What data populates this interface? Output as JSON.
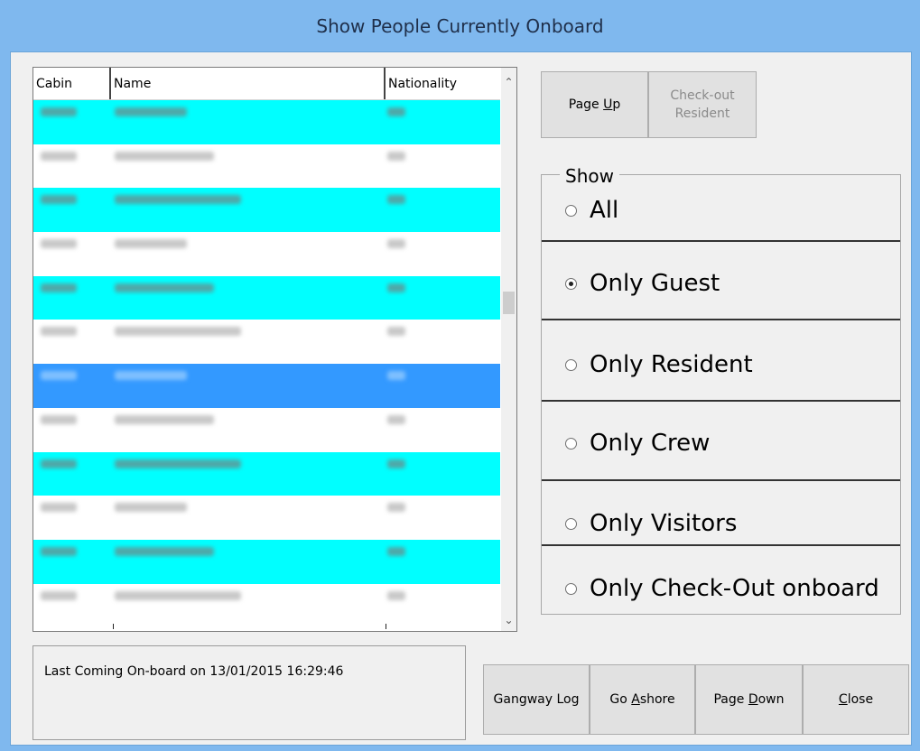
{
  "window": {
    "title": "Show People Currently Onboard"
  },
  "list": {
    "columns": [
      "Cabin",
      "Name",
      "Nationality"
    ],
    "rows": [
      {
        "color": "#00ffff"
      },
      {
        "color": "#ffffff"
      },
      {
        "color": "#00ffff"
      },
      {
        "color": "#ffffff"
      },
      {
        "color": "#00ffff"
      },
      {
        "color": "#ffffff"
      },
      {
        "color": "#3399ff"
      },
      {
        "color": "#ffffff"
      },
      {
        "color": "#00ffff"
      },
      {
        "color": "#ffffff"
      },
      {
        "color": "#00ffff"
      },
      {
        "color": "#ffffff"
      }
    ]
  },
  "buttons": {
    "page_up_pre": "Page ",
    "page_up_u": "U",
    "page_up_post": "p",
    "checkout_line1": "Check-out",
    "checkout_line2": "Resident",
    "gangway_log": "Gangway Log",
    "go_ashore_pre": "Go ",
    "go_ashore_u": "A",
    "go_ashore_post": "shore",
    "page_down_pre": "Page ",
    "page_down_u": "D",
    "page_down_post": "own",
    "close_u": "C",
    "close_post": "lose"
  },
  "show_group": {
    "legend": "Show",
    "options": [
      "All",
      "Only Guest",
      "Only Resident",
      "Only Crew",
      "Only Visitors",
      "Only Check-Out onboard"
    ],
    "selected": "Only Guest"
  },
  "status": {
    "text": "Last Coming On-board on 13/01/2015 16:29:46"
  },
  "colors": {
    "row_alt": "#00ffff",
    "row_selected": "#3399ff",
    "titlebar": "#7fb8ee"
  }
}
